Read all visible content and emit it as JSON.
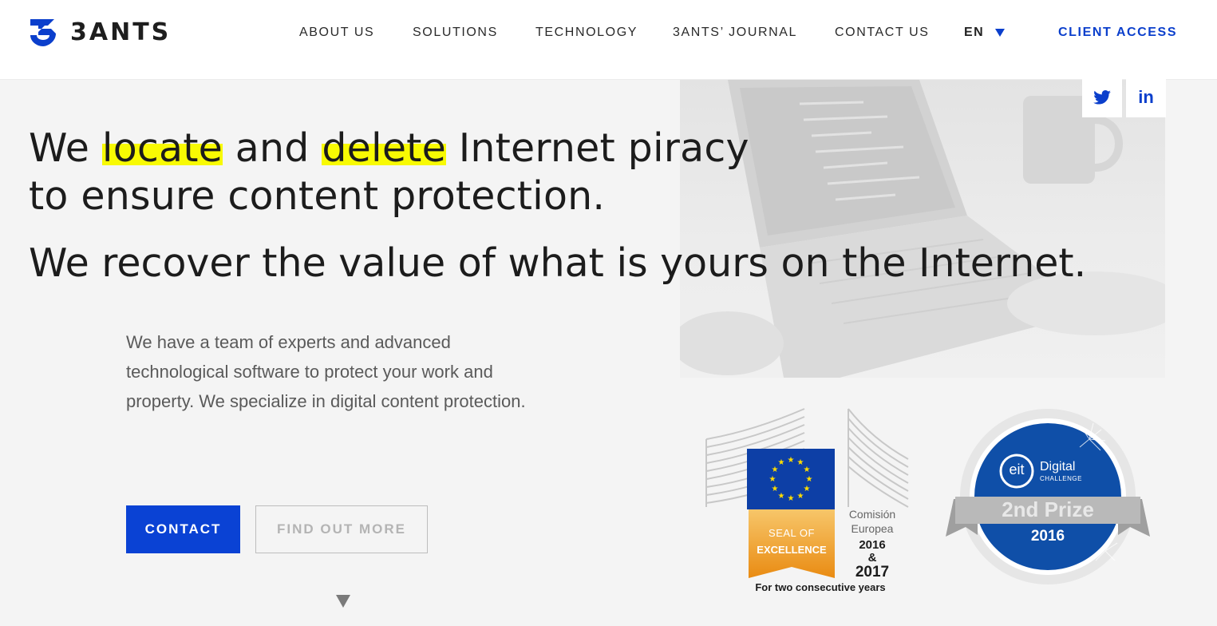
{
  "brand": {
    "name": "3ANTS",
    "accent_color": "#0b3fcc",
    "highlight_color": "#f8fa03"
  },
  "nav": {
    "items": [
      {
        "label": "ABOUT US"
      },
      {
        "label": "SOLUTIONS"
      },
      {
        "label": "TECHNOLOGY"
      },
      {
        "label": "3ANTS’ JOURNAL"
      },
      {
        "label": "CONTACT US"
      }
    ],
    "language": "EN",
    "client_access": "CLIENT ACCESS"
  },
  "social": {
    "twitter_icon": "twitter-icon",
    "linkedin_icon": "linkedin-icon",
    "linkedin_text": "in"
  },
  "hero": {
    "line1_a": "We ",
    "line1_hl1": "locate",
    "line1_b": " and ",
    "line1_hl2": "delete",
    "line1_c": " Internet piracy",
    "line1_d": "to ensure content protection.",
    "line2": "We recover the value of what is yours on the Internet.",
    "intro": "We have a team of experts and advanced technological software to protect your work and property. We specialize in digital content protection.",
    "contact_button": "CONTACT",
    "find_out_more_button": "FIND OUT MORE"
  },
  "badges": {
    "eu_seal": {
      "ribbon_line1": "SEAL OF",
      "ribbon_line2": "EXCELLENCE",
      "org_line1": "Comisión",
      "org_line2": "Europea",
      "year1": "2016",
      "amp": "&",
      "year2": "2017",
      "caption": "For two consecutive years"
    },
    "eit": {
      "logo_text": "eit",
      "title": "Digital",
      "subtitle": "CHALLENGE",
      "prize": "2nd Prize",
      "year": "2016"
    }
  }
}
